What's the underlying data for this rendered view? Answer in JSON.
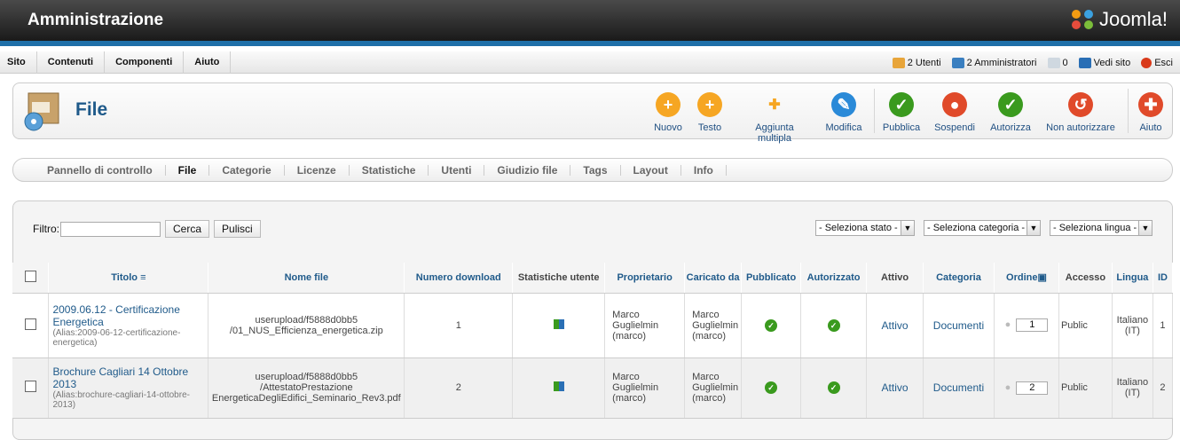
{
  "header": {
    "title": "Amministrazione",
    "logo": "Joomla!"
  },
  "menu": [
    "Sito",
    "Contenuti",
    "Componenti",
    "Aiuto"
  ],
  "status": {
    "users": "2 Utenti",
    "admins": "2 Amministratori",
    "messages": "0",
    "view_site": "Vedi sito",
    "logout": "Esci"
  },
  "toolbar": {
    "title": "File",
    "buttons": [
      "Nuovo",
      "Testo",
      "Aggiunta multipla",
      "Modifica",
      "Pubblica",
      "Sospendi",
      "Autorizza",
      "Non autorizzare",
      "Aiuto"
    ]
  },
  "subnav": [
    "Pannello di controllo",
    "File",
    "Categorie",
    "Licenze",
    "Statistiche",
    "Utenti",
    "Giudizio file",
    "Tags",
    "Layout",
    "Info"
  ],
  "filter": {
    "label": "Filtro:",
    "search": "Cerca",
    "clear": "Pulisci",
    "state": "- Seleziona stato -",
    "category": "- Seleziona categoria -",
    "language": "- Seleziona lingua -"
  },
  "columns": [
    "Titolo",
    "Nome file",
    "Numero download",
    "Statistiche utente",
    "Proprietario",
    "Caricato da",
    "Pubblicato",
    "Autorizzato",
    "Attivo",
    "Categoria",
    "Ordine",
    "Accesso",
    "Lingua",
    "ID"
  ],
  "rows": [
    {
      "title": "2009.06.12 - Certificazione Energetica",
      "alias": "(Alias:2009-06-12-certificazione-energetica)",
      "file": "userupload/f5888d0bb5 /01_NUS_Efficienza_energetica.zip",
      "downloads": "1",
      "owner": "Marco Guglielmin (marco)",
      "uploaded": "Marco Guglielmin (marco)",
      "active": "Attivo",
      "category": "Documenti",
      "order": "1",
      "access": "Public",
      "lang": "Italiano (IT)",
      "id": "1"
    },
    {
      "title": "Brochure Cagliari 14 Ottobre 2013",
      "alias": "(Alias:brochure-cagliari-14-ottobre-2013)",
      "file": "userupload/f5888d0bb5 /AttestatoPrestazione EnergeticaDegliEdifici_Seminario_Rev3.pdf",
      "downloads": "2",
      "owner": "Marco Guglielmin (marco)",
      "uploaded": "Marco Guglielmin (marco)",
      "active": "Attivo",
      "category": "Documenti",
      "order": "2",
      "access": "Public",
      "lang": "Italiano (IT)",
      "id": "2"
    }
  ]
}
